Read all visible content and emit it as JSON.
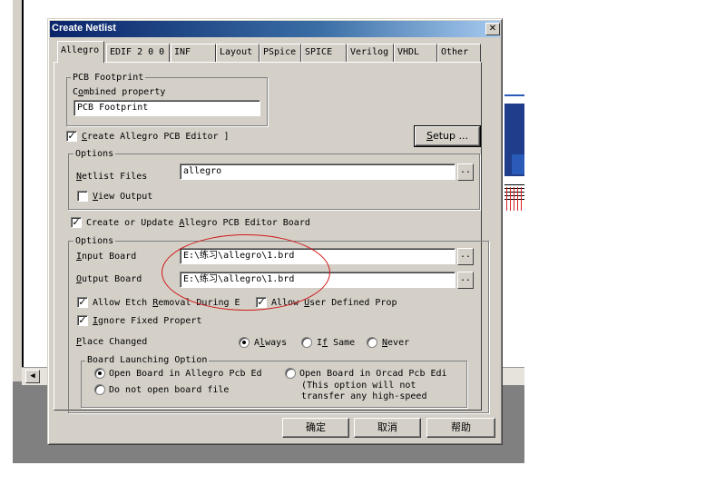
{
  "dialog": {
    "title": "Create Netlist",
    "close_symbol": "✕"
  },
  "tabs": [
    {
      "label": "Allegro",
      "active": true
    },
    {
      "label": "EDIF 2 0 0"
    },
    {
      "label": "INF"
    },
    {
      "label": "Layout"
    },
    {
      "label": "PSpice"
    },
    {
      "label": "SPICE"
    },
    {
      "label": "Verilog"
    },
    {
      "label": "VHDL"
    },
    {
      "label": "Other"
    }
  ],
  "pcb_footprint": {
    "legend": "PCB Footprint",
    "combined_label_pre": "C",
    "combined_label_u": "o",
    "combined_label_post": "mbined property",
    "value": "PCB Footprint"
  },
  "create_editor": {
    "checked": true,
    "label_u": "C",
    "label_rest": "reate Allegro PCB Editor ]"
  },
  "setup_button": {
    "label_u": "S",
    "label_rest": "etup ..."
  },
  "options1": {
    "legend": "Options",
    "netlist_label_u": "N",
    "netlist_label_rest": "etlist Files",
    "netlist_value": "allegro",
    "view_output_u": "V",
    "view_output_rest": "iew Output",
    "view_output_checked": false
  },
  "update_board": {
    "checked": true,
    "label_pre": "Create or Update ",
    "label_u": "A",
    "label_rest": "llegro PCB Editor Board"
  },
  "options2": {
    "legend": "Options",
    "input_label_u": "I",
    "input_label_rest": "nput Board",
    "input_value": "E:\\练习\\allegro\\1.brd",
    "output_label_u": "O",
    "output_label_rest": "utput Board",
    "output_value": "E:\\练习\\allegro\\1.brd",
    "browse_symbol": "..",
    "allow_etch_pre": "Allow Etch ",
    "allow_etch_u": "R",
    "allow_etch_rest": "emoval During E",
    "allow_etch_checked": true,
    "allow_user_pre": "Allow ",
    "allow_user_u": "U",
    "allow_user_rest": "ser Defined Prop",
    "allow_user_checked": true,
    "ignore_u": "I",
    "ignore_rest": "gnore Fixed Propert",
    "ignore_checked": true,
    "place_changed_u": "P",
    "place_changed_rest": "lace Changed",
    "radio_always_pre": "A",
    "radio_always_u": "l",
    "radio_always_rest": "ways",
    "radio_ifsame_pre": "I",
    "radio_ifsame_u": "f",
    "radio_ifsame_rest": " Same",
    "radio_never_u": "N",
    "radio_never_rest": "ever",
    "selected": "Always"
  },
  "board_launch": {
    "legend": "Board Launching Option",
    "open_allegro": "Open Board in Allegro Pcb Ed",
    "open_orcad": "Open Board in Orcad Pcb Edi",
    "do_not_open": "Do not open board file",
    "orcad_note1": "(This option will not",
    "orcad_note2": "transfer any high-speed",
    "selected": "Open Board in Allegro Pcb Ed"
  },
  "footer": {
    "ok": "确定",
    "cancel": "取消",
    "help": "帮助"
  },
  "colors": {
    "title_start": "#0a246a",
    "title_end": "#a6caf0",
    "annotation": "#d01818",
    "face": "#d4d0c8"
  }
}
